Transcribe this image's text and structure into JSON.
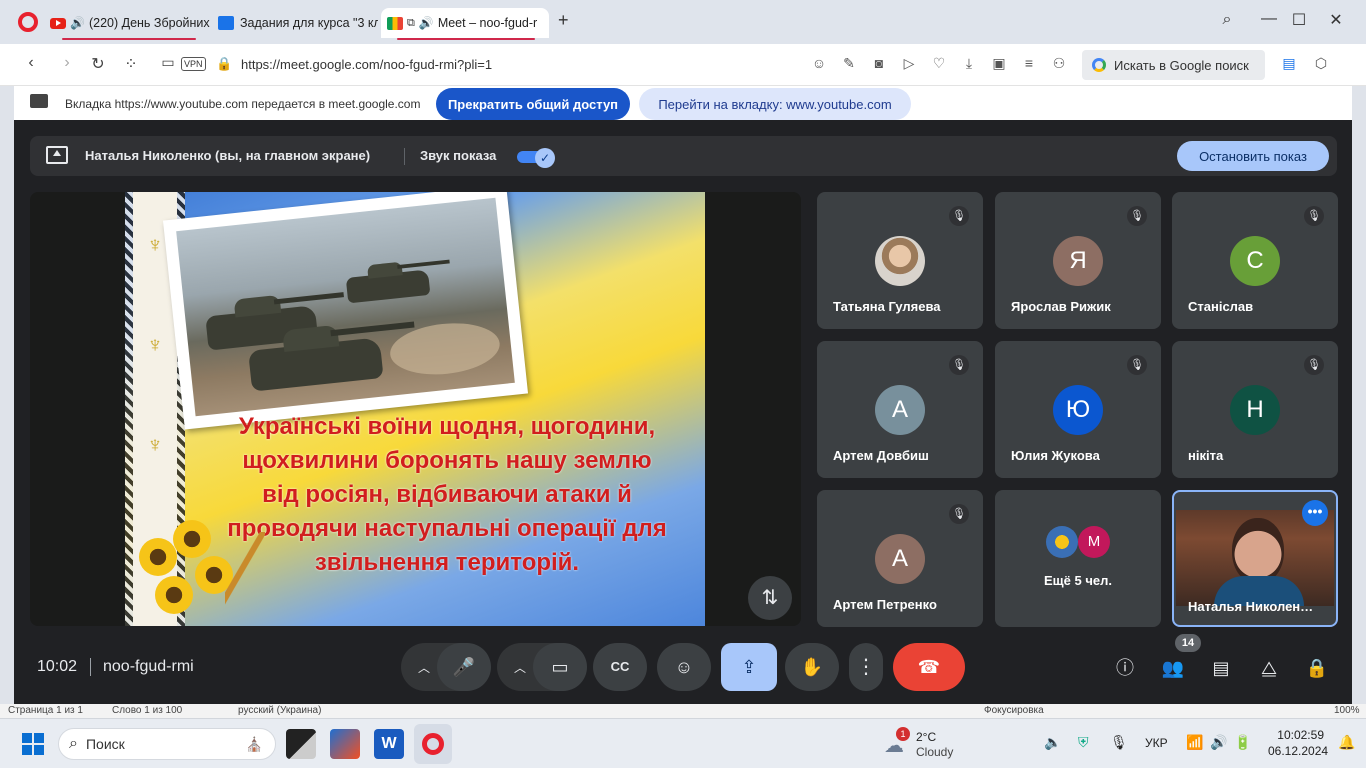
{
  "browser": {
    "tabs": [
      {
        "title": "(220) День Збройних",
        "has_sound": true,
        "icon": "youtube-icon"
      },
      {
        "title": "Задания для курса \"3 кла",
        "icon": "classroom-icon"
      },
      {
        "title": "Meet – noo-fgud-r",
        "icon": "meet-icon",
        "has_sound": true,
        "active": true
      }
    ],
    "new_tab": "+",
    "url": "https://meet.google.com/noo-fgud-rmi?pli=1",
    "vpn_label": "VPN",
    "search_placeholder": "Искать в Google поиск"
  },
  "share_notice": {
    "text": "Вкладка https://www.youtube.com передается в meet.google.com",
    "stop_button": "Прекратить общий доступ",
    "goto_button": "Перейти на вкладку: www.youtube.com"
  },
  "meet": {
    "presenter_label": "Наталья Николенко (вы, на главном экране)",
    "sound_label": "Звук показа",
    "sound_on": true,
    "stop_presenting": "Остановить показ",
    "slide_text_lines": [
      "Українські воїни щодня, щогодини,",
      "щохвилини боронять нашу землю",
      "від росіян, відбиваючи атаки й",
      "проводячи наступальні операції для",
      "звільнення територій."
    ],
    "participants": [
      {
        "name": "Татьяна Гуляева",
        "initial": "",
        "color": "#d8d3cc",
        "muted": true
      },
      {
        "name": "Ярослав Рижик",
        "initial": "Я",
        "color": "#8d6e63",
        "muted": true
      },
      {
        "name": "Станіслав",
        "initial": "С",
        "color": "#689f38",
        "muted": true
      },
      {
        "name": "Артем Довбиш",
        "initial": "А",
        "color": "#78909c",
        "muted": true
      },
      {
        "name": "Юлия Жукова",
        "initial": "Ю",
        "color": "#0b57d0",
        "muted": true
      },
      {
        "name": "нікіта",
        "initial": "Н",
        "color": "#0f5243",
        "muted": true
      },
      {
        "name": "Артем Петренко",
        "initial": "А",
        "color": "#8d6e63",
        "muted": true
      }
    ],
    "more_participants": {
      "text": "Ещё 5 чел.",
      "avatar_initial": "М",
      "avatar_color": "#c2185b"
    },
    "self_tile_name": "Наталья Николен…",
    "time": "10:02",
    "meeting_code": "noo-fgud-rmi",
    "people_count": "14"
  },
  "word_status": {
    "page": "Страница 1 из 1",
    "words": "Слово 1 из 100",
    "lang": "русский (Украина)",
    "focus": "Фокусировка",
    "zoom": "100%"
  },
  "taskbar": {
    "search_placeholder": "Поиск",
    "weather_temp": "2°C",
    "weather_desc": "Cloudy",
    "weather_badge": "1",
    "language": "УКР",
    "time": "10:02:59",
    "date": "06.12.2024"
  }
}
